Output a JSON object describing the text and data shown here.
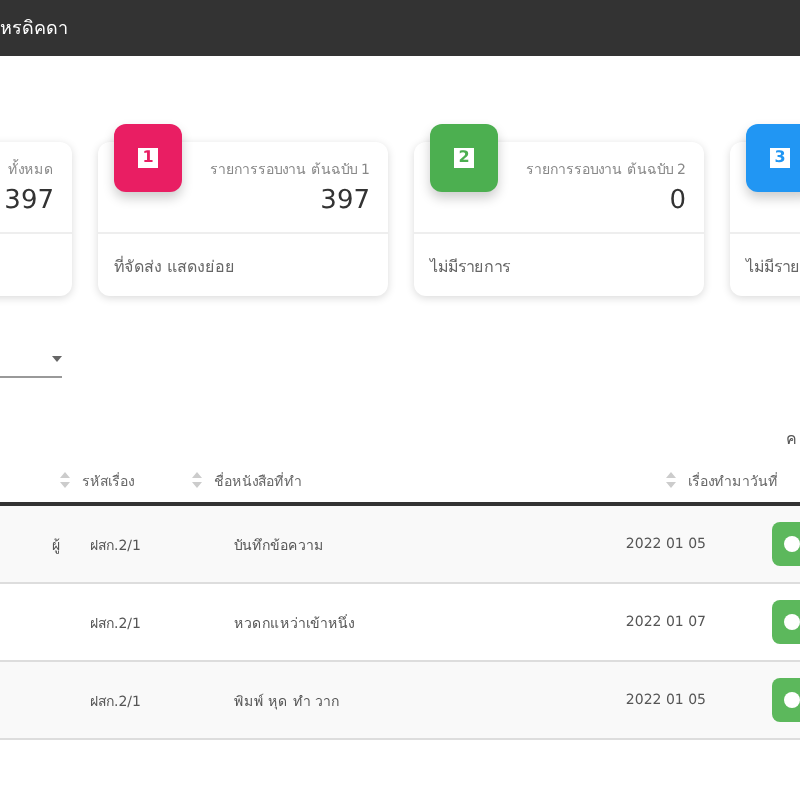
{
  "header": {
    "title": "หรดิคดา"
  },
  "cards": [
    {
      "label": "ทั้งหมด",
      "value": "397"
    },
    {
      "color": "#e91e63",
      "badge": "1",
      "label": "รายการรอบงาน ต้นฉบับ 1",
      "value": "397",
      "footer": "ที่จัดส่ง แสดงย่อย"
    },
    {
      "color": "#4caf50",
      "badge": "2",
      "label": "รายการรอบงาน ต้นฉบับ 2",
      "value": "0",
      "footer": "ไม่มีรายการ"
    },
    {
      "color": "#2196f3",
      "badge": "3",
      "footer": "ไม่มีราย"
    }
  ],
  "search": {
    "label": "ค"
  },
  "table": {
    "columns": [
      "รหัสเรื่อง",
      "ชื่อหนังสือที่ทำ",
      "เรื่องทำมาวันที่"
    ],
    "rows": [
      {
        "column_1": "ผู้",
        "code": "ฝสก.2/1",
        "title": "บันทึกข้อความ",
        "date": "2022 01 05"
      },
      {
        "column_1": "",
        "code": "ฝสก.2/1",
        "title": "หวดกแหว่าเข้าหนึ่ง",
        "date": "2022 01 07"
      },
      {
        "column_1": "",
        "code": "ฝสก.2/1",
        "title": "พิมพ์ หุด ทำ วาก",
        "date": "2022 01 05"
      }
    ]
  }
}
